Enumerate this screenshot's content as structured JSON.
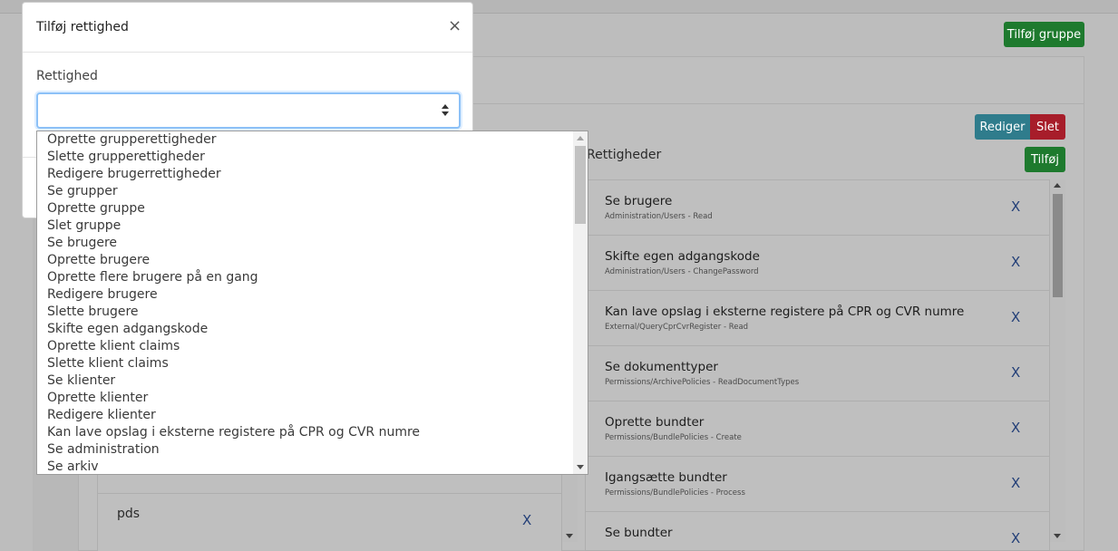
{
  "header": {
    "add_group_label": "Tilføj gruppe"
  },
  "group_actions": {
    "edit_label": "Rediger",
    "delete_label": "Slet"
  },
  "rights_panel": {
    "title": "Rettigheder",
    "add_label": "Tilføj",
    "items": [
      {
        "name": "Se brugere",
        "key": "Administration/Users - Read",
        "remove": "X"
      },
      {
        "name": "Skifte egen adgangskode",
        "key": "Administration/Users - ChangePassword",
        "remove": "X"
      },
      {
        "name": "Kan lave opslag i eksterne registere på CPR og CVR numre",
        "key": "External/QueryCprCvrRegister - Read",
        "remove": "X"
      },
      {
        "name": "Se dokumenttyper",
        "key": "Permissions/ArchivePolicies - ReadDocumentTypes",
        "remove": "X"
      },
      {
        "name": "Oprette bundter",
        "key": "Permissions/BundlePolicies - Create",
        "remove": "X"
      },
      {
        "name": "Igangsætte bundter",
        "key": "Permissions/BundlePolicies - Process",
        "remove": "X"
      },
      {
        "name": "Se bundter",
        "key": "",
        "remove": "X"
      }
    ]
  },
  "groups_panel": {
    "items": [
      {
        "name": "pds",
        "remove": "X"
      }
    ]
  },
  "modal": {
    "title": "Tilføj rettighed",
    "close": "×",
    "field_label": "Rettighed",
    "selected_value": "",
    "options": [
      "Oprette grupperettigheder",
      "Slette grupperettigheder",
      "Redigere brugerrettigheder",
      "Se grupper",
      "Oprette gruppe",
      "Slet gruppe",
      "Se brugere",
      "Oprette brugere",
      "Oprette flere brugere på en gang",
      "Redigere brugere",
      "Slette brugere",
      "Skifte egen adgangskode",
      "Oprette klient claims",
      "Slette klient claims",
      "Se klienter",
      "Oprette klienter",
      "Redigere klienter",
      "Kan lave opslag i eksterne registere på CPR og CVR numre",
      "Se administration",
      "Se arkiv"
    ]
  }
}
